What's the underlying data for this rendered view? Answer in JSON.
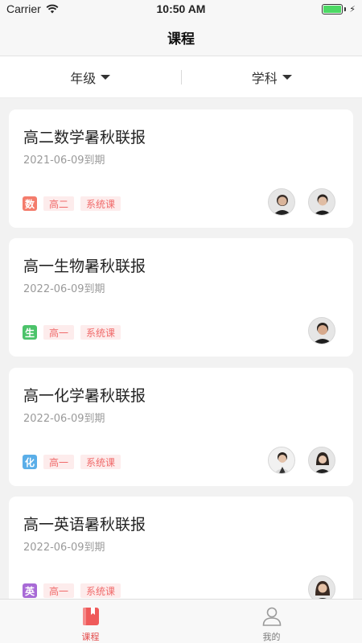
{
  "status_bar": {
    "carrier": "Carrier",
    "time": "10:50 AM"
  },
  "nav": {
    "title": "课程"
  },
  "filters": [
    {
      "label": "年级"
    },
    {
      "label": "学科"
    }
  ],
  "courses": [
    {
      "title": "高二数学暑秋联报",
      "expiry": "2021-06-09到期",
      "subject_badge": "数",
      "badge_color": "#f47c6c",
      "grade": "高二",
      "type": "系统课",
      "teachers": 2
    },
    {
      "title": "高一生物暑秋联报",
      "expiry": "2022-06-09到期",
      "subject_badge": "生",
      "badge_color": "#4cc36a",
      "grade": "高一",
      "type": "系统课",
      "teachers": 1
    },
    {
      "title": "高一化学暑秋联报",
      "expiry": "2022-06-09到期",
      "subject_badge": "化",
      "badge_color": "#5aaee8",
      "grade": "高一",
      "type": "系统课",
      "teachers": 2
    },
    {
      "title": "高一英语暑秋联报",
      "expiry": "2022-06-09到期",
      "subject_badge": "英",
      "badge_color": "#a86ad6",
      "grade": "高一",
      "type": "系统课",
      "teachers": 1
    }
  ],
  "tab_bar": {
    "items": [
      {
        "label": "课程",
        "icon": "book-icon",
        "active": true
      },
      {
        "label": "我的",
        "icon": "person-icon",
        "active": false
      }
    ]
  },
  "colors": {
    "accent": "#e34a4a",
    "tag_bg": "#fdecec",
    "tag_text": "#f06a6a"
  }
}
